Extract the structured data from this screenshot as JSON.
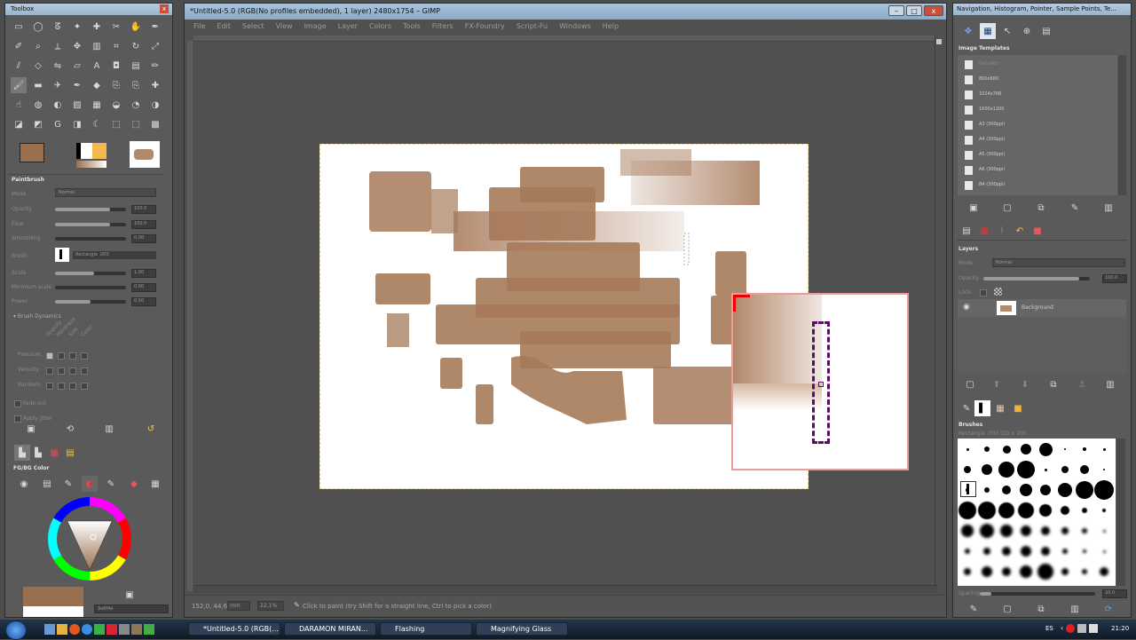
{
  "toolbox": {
    "title": "Toolbox",
    "tool_options_title": "Paintbrush",
    "mode_label": "Mode",
    "mode_value": "Normal",
    "opacity_label": "Opacity",
    "opacity_value": "100.0",
    "flow_label": "Flow",
    "flow_value": "100.0",
    "smoothing_label": "Smoothing",
    "smoothing_value": "0.00",
    "brush_label": "Brush",
    "brush_value": "Rectangle .000",
    "scale_label": "Scale",
    "scale_value": "1.00",
    "min_scale_label": "Minimum scale",
    "min_scale_value": "0.00",
    "power_label": "Power",
    "power_value": "0.50",
    "brush_dynamics_label": "Brush Dynamics",
    "dynamics_columns": [
      "Opacity",
      "Hardness",
      "Size",
      "Color"
    ],
    "dynamics_rows": [
      "Pressure:",
      "Velocity:",
      "Random:"
    ],
    "fade_out_label": "Fade out",
    "apply_jitter_label": "Apply Jitter",
    "fgbg_title": "FG/BG Color",
    "hex_value": "9a6f4e",
    "fg_color": "#9a6f4e",
    "bg_color": "#ffffff"
  },
  "image_window": {
    "title": "*Untitled-5.0 (RGB(No profiles embedded), 1 layer) 2480x1754 – GIMP",
    "menu": [
      "File",
      "Edit",
      "Select",
      "View",
      "Image",
      "Layer",
      "Colors",
      "Tools",
      "Filters",
      "FX-Foundry",
      "Script-Fu",
      "Windows",
      "Help"
    ],
    "coords": "152,0, 44,6",
    "unit": "mm",
    "zoom": "22,1%",
    "status": "Click to paint (try Shift for a straight line, Ctrl to pick a color)"
  },
  "dock": {
    "title": "Navigation, Histogram, Pointer, Sample Points, Te...",
    "templates_title": "Image Templates",
    "templates": [
      "640x480",
      "800x600",
      "1024x768",
      "1600x1200",
      "A3 (300ppi)",
      "A4 (300ppi)",
      "A5 (300ppi)",
      "A6 (300ppi)",
      "B4 (300ppi)"
    ],
    "layers_title": "Layers",
    "layers_mode_label": "Mode",
    "layers_mode_value": "Normal",
    "layers_opacity_label": "Opacity",
    "layers_opacity_value": "100.0",
    "layers_lock_label": "Lock:",
    "layer_name": "Background",
    "brushes_title": "Brushes",
    "brushes_subtitle": "Rectangle .000 (20 × 20)",
    "spacing_label": "Spacing",
    "spacing_value": "20.0"
  },
  "taskbar": {
    "items": [
      "*Untitled-5.0 (RGB(...",
      "DARAMON MIRAN...",
      "Flashing",
      "Magnifying Glass"
    ],
    "language": "ES",
    "time": "21:20"
  },
  "icons": {
    "eye": "eye-icon",
    "start": "windows-start-icon"
  }
}
